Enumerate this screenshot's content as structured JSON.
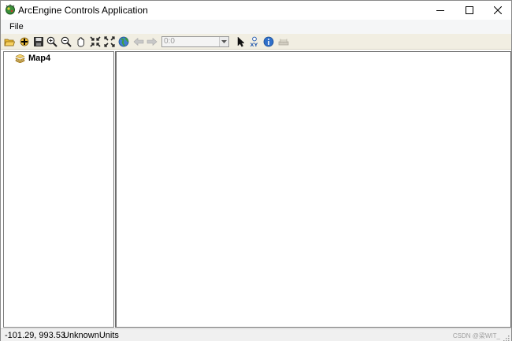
{
  "window": {
    "title": "ArcEngine Controls Application"
  },
  "menu": {
    "items": [
      {
        "label": "File"
      }
    ]
  },
  "toolbar": {
    "tools": [
      "open-icon",
      "add-data-icon",
      "save-icon",
      "zoom-in-icon",
      "zoom-out-icon",
      "pan-icon",
      "fixed-zoom-in-icon",
      "full-extent-icon",
      "globe-icon",
      "back-extent-icon",
      "forward-extent-icon",
      "select-features-icon",
      "go-to-xy-icon",
      "identify-icon",
      "measure-icon"
    ],
    "scale_value": "0:0"
  },
  "toc": {
    "map_name": "Map4"
  },
  "status": {
    "coordinates": "-101.29, 993.53",
    "units": "UnknownUnits",
    "watermark": "CSDN @梁WIT_"
  },
  "colors": {
    "toolbar_bg": "#f1eee2",
    "menubar_bg": "#f5f6f7",
    "statusbar_bg": "#f0f0f0"
  }
}
